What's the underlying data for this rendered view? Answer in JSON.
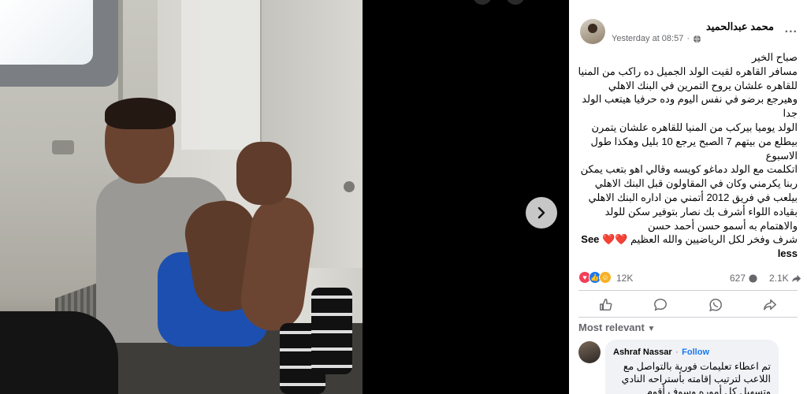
{
  "post": {
    "author": "محمد عبدالحميد",
    "time": "Yesterday at 08:57",
    "more_label": "...",
    "text_lines": [
      "صباح الخير",
      "مسافر القاهره لقيت الولد الجميل ده راكب من المنيا للقاهره علشان يروح التمرين في البنك الاهلي",
      "وهيرجع برضو في نفس اليوم وده حرفيا هيتعب الولد جدا",
      "الولد يوميا بيركب من المنيا للقاهره علشان يتمرن بيطلع من بيتهم 7 الصبح يرجع 10 بليل وهكذا طول الاسبوع",
      "اتكلمت مع الولد دماغو كويسه وقالي اهو بتعب يمكن ربنا يكرمني وكان في المقاولون قبل البنك الاهلي بيلعب في فريق 2012 أتمني من اداره البنك الاهلي بقياده اللواء أشرف بك نصار بتوفير سكن للولد والاهتمام به أسمو حسن أحمد حسن",
      "شرف وفخر لكل الرياضيين والله العظيم ❤️❤️"
    ],
    "see_less": "See less"
  },
  "stats": {
    "reactions": "12K",
    "comments": "627",
    "shares": "2.1K"
  },
  "comments_section": {
    "sort_label": "Most relevant",
    "first_comment": {
      "author": "Ashraf Nassar",
      "separator": "·",
      "follow": "Follow",
      "text": "تم اعطاء تعليمات فورية بالتواصل مع اللاعب لترتيب إقامته بأستراحه النادي وتسهيل كل أموره وسوف أقوم بمقابلته"
    }
  },
  "colors": {
    "accent": "#1877f2",
    "like_blue": "#1877f2",
    "love_red": "#f33e58",
    "care_yellow": "#f7b125"
  },
  "icons": {
    "next": "chevron-right-icon",
    "privacy": "globe-icon",
    "like": "thumbs-up-icon",
    "comment": "comment-icon",
    "whatsapp": "whatsapp-icon",
    "share": "share-icon"
  }
}
